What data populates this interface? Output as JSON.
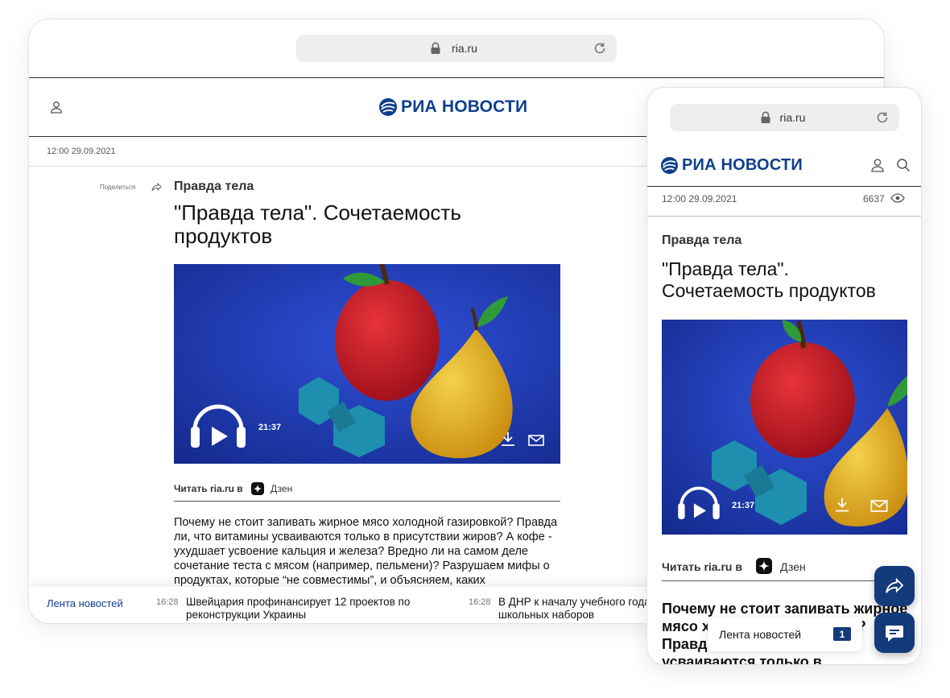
{
  "colors": {
    "brand": "#0e3f8c",
    "fab": "#133a7a",
    "media_bg": "#1d36b0"
  },
  "desktop": {
    "url": "ria.ru",
    "logo_text": "РИА НОВОСТИ",
    "datetime": "12:00 29.09.2021",
    "share_label": "Поделиться",
    "rubric": "Правда тела",
    "title": "\"Правда тела\". Сочетаемость продуктов",
    "media_duration": "21:37",
    "read_on_label": "Читать ria.ru в",
    "dzen_label": "Дзен",
    "body_text": "Почему не стоит запивать жирное мясо холодной газировкой? Правда ли, что витамины усваиваются только в присутствии жиров? А кофе - ухудшает усвоение кальция и железа? Вредно ли на самом деле сочетание теста с мясом (например, пельмени)? Разрушаем мифы о продуктах, которые “не совместимы”, и объясняем, каких",
    "news_feed": {
      "title": "Лента новостей",
      "items": [
        {
          "time": "16:28",
          "text": "Швейцария профинансирует 12 проектов по реконструкции Украины"
        },
        {
          "time": "16:28",
          "text": "В ДНР к началу учебного года школьных наборов"
        }
      ]
    }
  },
  "mobile": {
    "url": "ria.ru",
    "logo_text": "РИА НОВОСТИ",
    "datetime": "12:00 29.09.2021",
    "views": "6637",
    "rubric": "Правда тела",
    "title": "\"Правда тела\". Сочетаемость продуктов",
    "media_duration": "21:37",
    "read_on_label": "Читать ria.ru в",
    "dzen_label": "Дзен",
    "body_text": "Почему не стоит запивать жирное мясо холодной газировкой? Правда ли, что витамины усваиваются только в присутствии",
    "news_pill": {
      "label": "Лента новостей",
      "count": "1"
    }
  }
}
